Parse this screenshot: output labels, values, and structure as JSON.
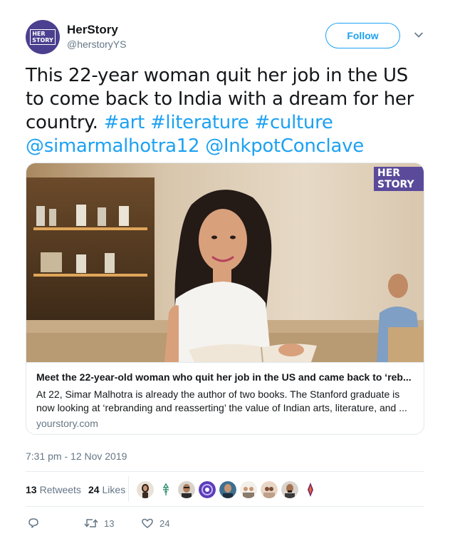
{
  "author": {
    "name": "HerStory",
    "handle": "@herstoryYS",
    "avatar_text": "HER STORY"
  },
  "follow_label": "Follow",
  "tweet": {
    "text_plain": "This 22-year woman quit her job in the US to come back to India with a dream for her country. ",
    "hashtag_art": "#art",
    "hashtag_literature": "#literature",
    "hashtag_culture": "#culture",
    "mention_1": "@simarmalhotra12",
    "mention_2": "@InkpotConclave"
  },
  "card": {
    "watermark": "HER STORY",
    "title": "Meet the 22-year-old woman who quit her job in the US and came back to ‘reb...",
    "description": "At 22, Simar Malhotra is already the author of two books. The Stanford graduate is now looking at ‘rebranding and reasserting’ the value of Indian arts, literature, and ...",
    "domain": "yourstory.com"
  },
  "timestamp": "7:31 pm - 12 Nov 2019",
  "stats": {
    "retweets_count": "13",
    "retweets_label": "Retweets",
    "likes_count": "24",
    "likes_label": "Likes"
  },
  "actions": {
    "reply_icon": "reply-icon",
    "retweet_icon": "retweet-icon",
    "retweet_count": "13",
    "like_icon": "heart-icon",
    "like_count": "24"
  },
  "colors": {
    "link": "#1da1f2",
    "secondary_text": "#657786",
    "avatar_bg": "#4b3f8f"
  }
}
